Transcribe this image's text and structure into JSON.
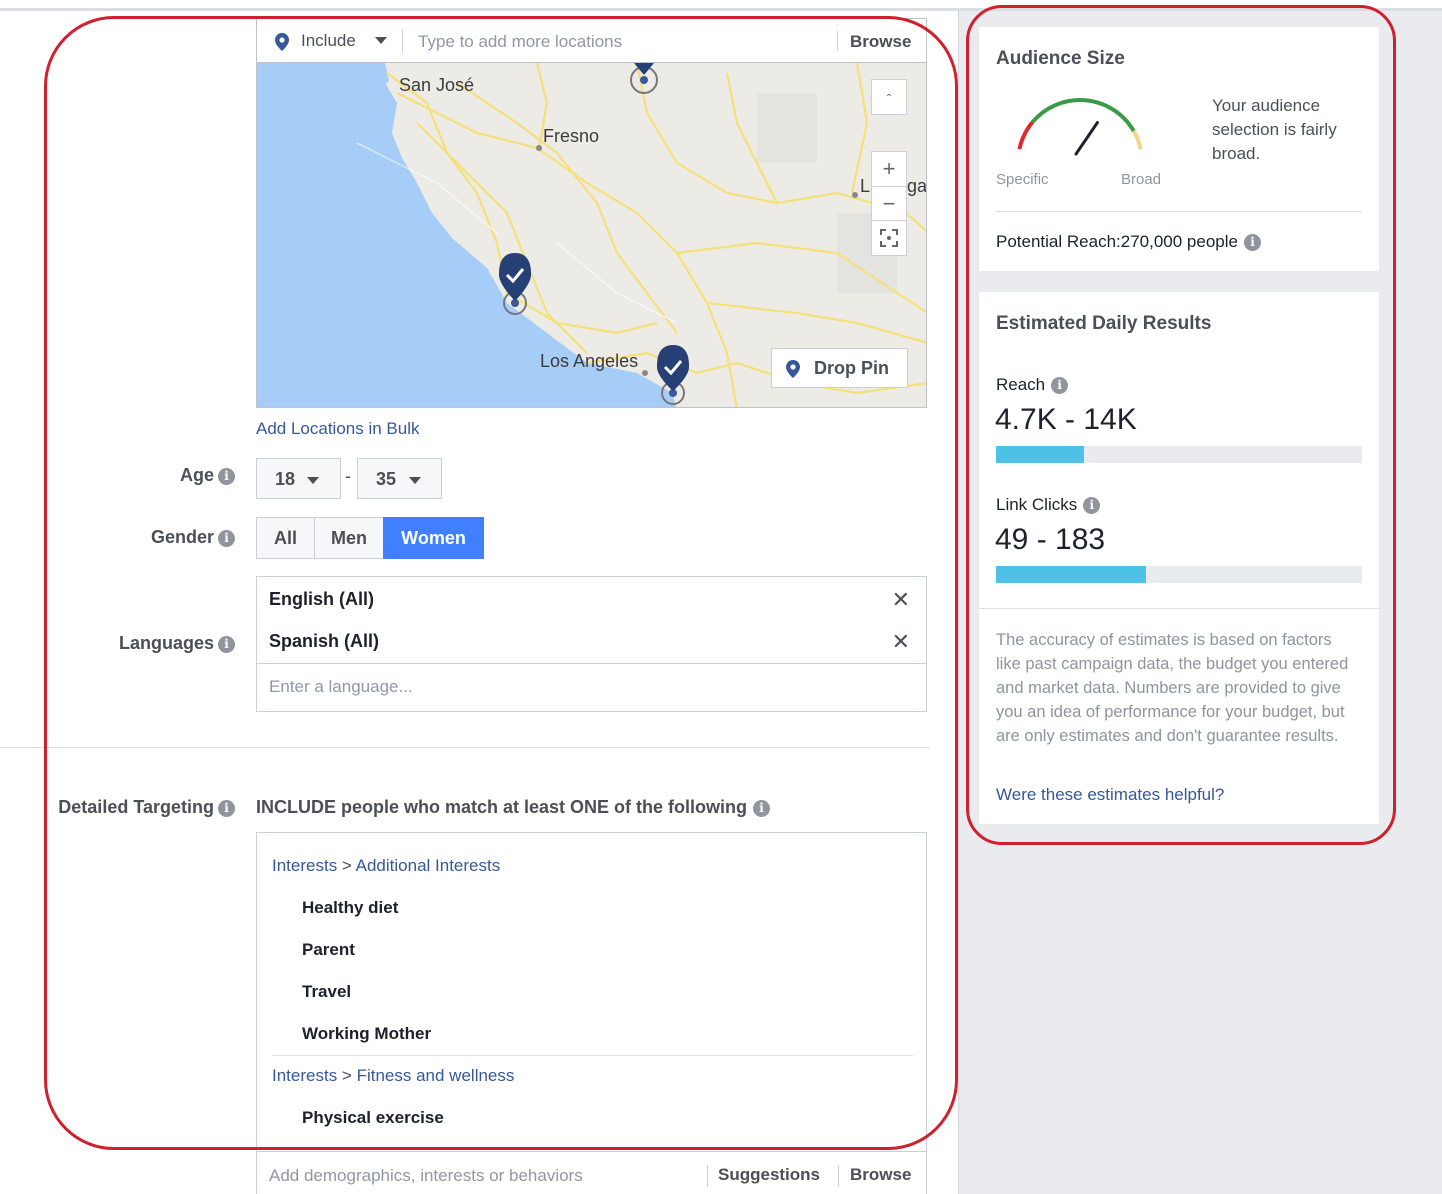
{
  "location": {
    "include_label": "Include",
    "placeholder": "Type to add more locations",
    "browse_label": "Browse",
    "map": {
      "cities": [
        "San José",
        "Fresno",
        "Los Angeles",
        "L"
      ],
      "edge_fragment": "ga",
      "zoom_in": "+",
      "zoom_out": "−",
      "collapse": "ˆ"
    },
    "drop_pin_label": "Drop Pin",
    "bulk_link": "Add Locations in Bulk"
  },
  "age": {
    "label": "Age",
    "min": "18",
    "max": "35",
    "separator": "-"
  },
  "gender": {
    "label": "Gender",
    "options": [
      "All",
      "Men",
      "Women"
    ],
    "selected": "Women"
  },
  "languages": {
    "label": "Languages",
    "selected": [
      "English (All)",
      "Spanish (All)"
    ],
    "remove_glyph": "✕",
    "placeholder": "Enter a language..."
  },
  "detailed_targeting": {
    "label": "Detailed Targeting",
    "include_text": "INCLUDE people who match at least ONE of the following",
    "groups": [
      {
        "prefix": "Interests",
        "arrow": " > ",
        "category": "Additional Interests",
        "items": [
          "Healthy diet",
          "Parent",
          "Travel",
          "Working Mother"
        ]
      },
      {
        "prefix": "Interests",
        "arrow": " > ",
        "category": "Fitness and wellness",
        "items": [
          "Physical exercise"
        ]
      }
    ],
    "add_placeholder": "Add demographics, interests or behaviors",
    "suggestions_label": "Suggestions",
    "browse_label": "Browse"
  },
  "audience_size": {
    "title": "Audience Size",
    "specific_label": "Specific",
    "broad_label": "Broad",
    "description": "Your audience selection is fairly broad.",
    "potential_reach": "Potential Reach:270,000 people",
    "gauge_level": 0.72,
    "colors": {
      "red": "#e0292f",
      "yellow": "#f0d58a",
      "green": "#3a9b46"
    }
  },
  "daily_results": {
    "title": "Estimated Daily Results",
    "reach": {
      "label": "Reach",
      "value": "4.7K - 14K",
      "fill": 0.24
    },
    "link_clicks": {
      "label": "Link Clicks",
      "value": "49 - 183",
      "fill": 0.41
    },
    "disclaimer": "The accuracy of estimates is based on factors like past campaign data, the budget you entered and market data. Numbers are provided to give you an idea of performance for your budget, but are only estimates and don't guarantee results.",
    "helpful_link": "Were these estimates helpful?",
    "bar_color": "#4ec1e7"
  },
  "info_glyph": "i"
}
